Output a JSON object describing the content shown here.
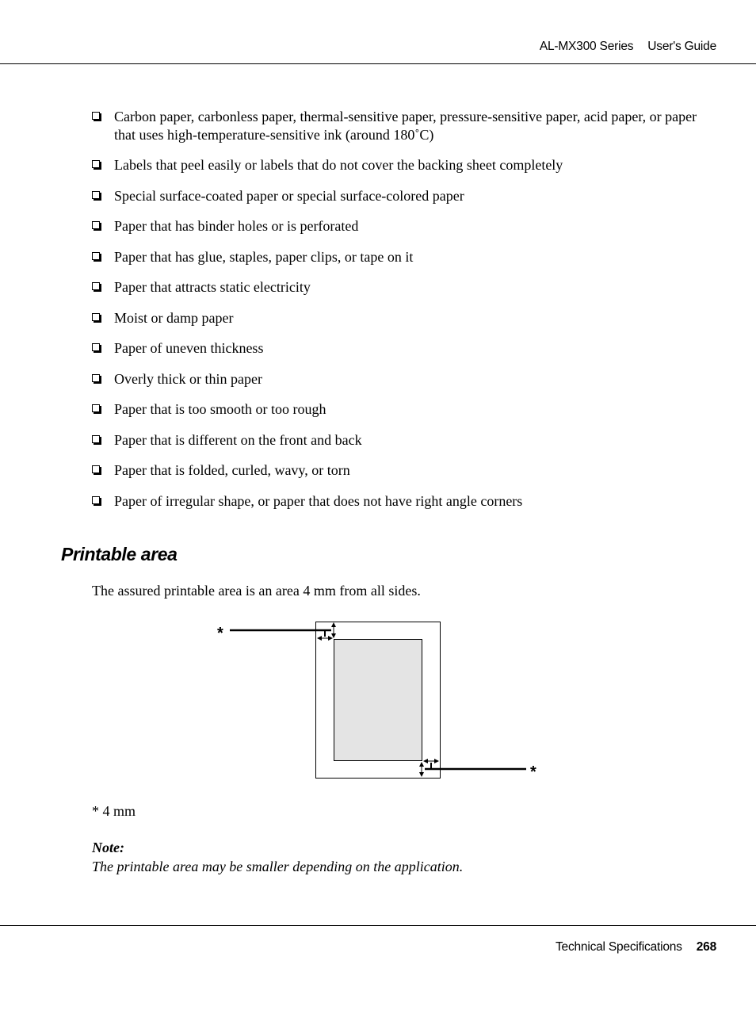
{
  "header": {
    "product": "AL-MX300 Series",
    "guide": "User's Guide"
  },
  "list": {
    "items": [
      "Carbon paper, carbonless paper, thermal-sensitive paper, pressure-sensitive paper, acid paper, or paper that uses high-temperature-sensitive ink (around 180˚C)",
      "Labels that peel easily or labels that do not cover the backing sheet completely",
      "Special surface-coated paper or special surface-colored paper",
      "Paper that has binder holes or is perforated",
      "Paper that has glue, staples, paper clips, or tape on it",
      "Paper that attracts static electricity",
      "Moist or damp paper",
      "Paper of uneven thickness",
      "Overly thick or thin paper",
      "Paper that is too smooth or too rough",
      "Paper that is different on the front and back",
      "Paper that is folded, curled, wavy, or torn",
      "Paper of irregular shape, or paper that does not have right angle corners"
    ]
  },
  "section": {
    "title": "Printable area",
    "intro": "The assured printable area is an area 4 mm from all sides."
  },
  "diagram": {
    "callout_top": "*",
    "callout_bottom": "*",
    "colors": {
      "printable_fill": "#e4e4e4",
      "stroke": "#000000"
    }
  },
  "footnote": "* 4 mm",
  "note": {
    "label": "Note:",
    "text": "The printable area may be smaller depending on the application."
  },
  "footer": {
    "chapter": "Technical Specifications",
    "page": "268"
  }
}
